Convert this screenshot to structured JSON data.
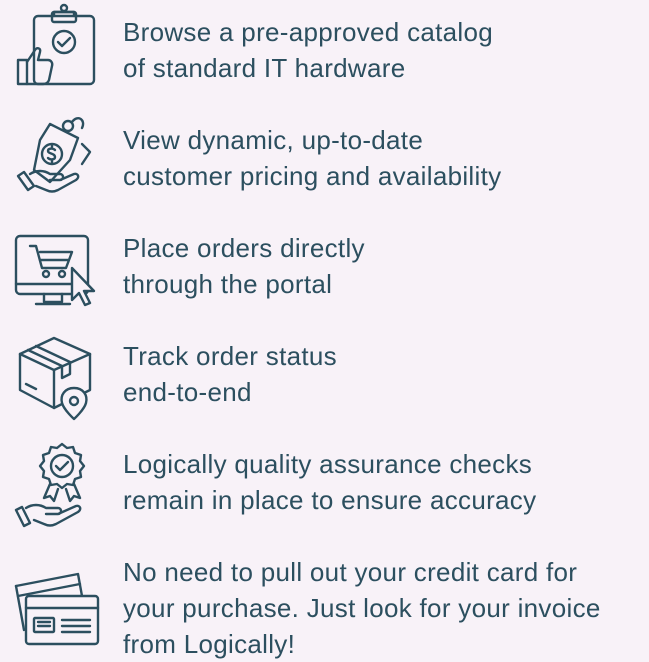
{
  "colors": {
    "background": "#f8f2f8",
    "text": "#2c4f5f",
    "icon_stroke": "#2c4f5f"
  },
  "features": [
    {
      "icon": "clipboard-thumbs-up-icon",
      "lines": [
        "Browse a pre-approved catalog",
        "of standard IT hardware"
      ]
    },
    {
      "icon": "price-tag-hand-icon",
      "lines": [
        "View dynamic, up-to-date",
        "customer pricing and availability"
      ]
    },
    {
      "icon": "shopping-cart-monitor-icon",
      "lines": [
        "Place orders directly",
        "through the portal"
      ]
    },
    {
      "icon": "package-location-icon",
      "lines": [
        "Track order status",
        "end-to-end"
      ]
    },
    {
      "icon": "quality-badge-hand-icon",
      "lines": [
        "Logically quality assurance checks",
        "remain in place to ensure accuracy"
      ]
    },
    {
      "icon": "invoice-cards-icon",
      "lines": [
        "No need to pull out your credit card for",
        "your purchase. Just look for your invoice",
        "from Logically!"
      ]
    }
  ]
}
